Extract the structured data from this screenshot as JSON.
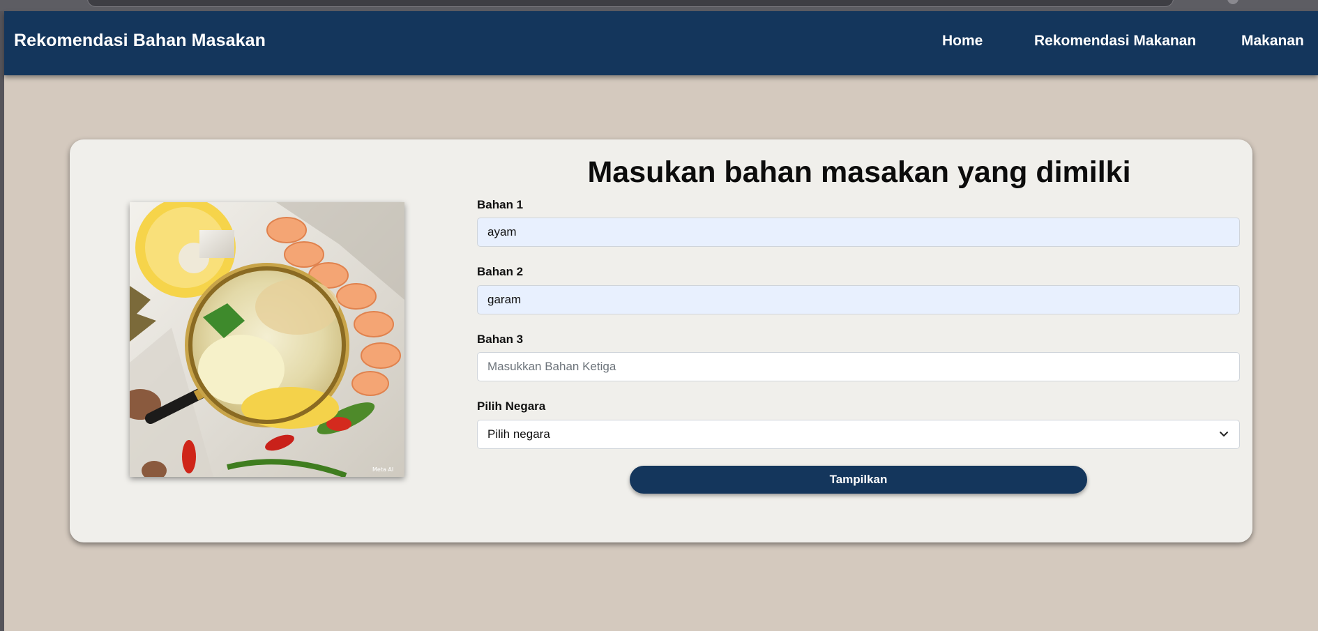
{
  "navbar": {
    "brand": "Rekomendasi Bahan Masakan",
    "links": [
      {
        "label": "Home"
      },
      {
        "label": "Rekomendasi Makanan"
      },
      {
        "label": "Makanan"
      }
    ]
  },
  "form": {
    "title": "Masukan bahan masakan yang dimilki",
    "bahan1": {
      "label": "Bahan 1",
      "value": "ayam"
    },
    "bahan2": {
      "label": "Bahan 2",
      "value": "garam"
    },
    "bahan3": {
      "label": "Bahan 3",
      "value": "",
      "placeholder": "Masukkan Bahan Ketiga"
    },
    "negara": {
      "label": "Pilih Negara",
      "selected": "Pilih negara"
    },
    "submit_label": "Tampilkan"
  },
  "image": {
    "subject": "magnifying glass over pineapple, shrimp and chili",
    "watermark": "Meta AI"
  },
  "colors": {
    "navbar": "#14365c",
    "page_bg": "#d4c9be",
    "card_bg": "#f0efeb",
    "button": "#14365c",
    "autofill": "#e8f0fe"
  }
}
